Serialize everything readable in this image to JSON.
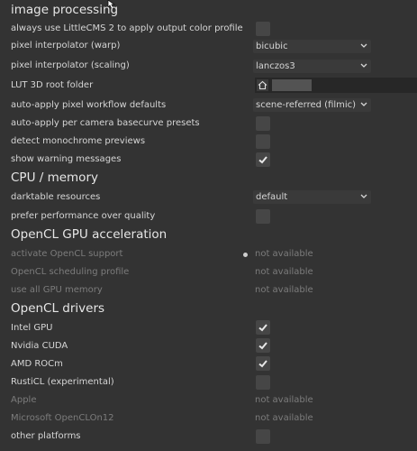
{
  "sections": {
    "image_processing": "image processing",
    "cpu_memory": "CPU / memory",
    "opencl_gpu": "OpenCL GPU acceleration",
    "opencl_drivers": "OpenCL drivers"
  },
  "image_processing": {
    "littlecms": {
      "label": "always use LittleCMS 2 to apply output color profile",
      "checked": false
    },
    "interp_warp": {
      "label": "pixel interpolator (warp)",
      "value": "bicubic"
    },
    "interp_scaling": {
      "label": "pixel interpolator (scaling)",
      "value": "lanczos3"
    },
    "lut_root": {
      "label": "LUT 3D root folder"
    },
    "workflow_defaults": {
      "label": "auto-apply pixel workflow defaults",
      "value": "scene-referred (filmic)"
    },
    "basecurve": {
      "label": "auto-apply per camera basecurve presets",
      "checked": false
    },
    "monochrome": {
      "label": "detect monochrome previews",
      "checked": false
    },
    "warnings": {
      "label": "show warning messages",
      "checked": true
    }
  },
  "cpu_memory": {
    "resources": {
      "label": "darktable resources",
      "value": "default"
    },
    "performance": {
      "label": "prefer performance over quality",
      "checked": false
    }
  },
  "opencl_gpu": {
    "activate": {
      "label": "activate OpenCL support",
      "value": "not available"
    },
    "scheduling": {
      "label": "OpenCL scheduling profile",
      "value": "not available"
    },
    "gpu_memory": {
      "label": "use all GPU memory",
      "value": "not available"
    }
  },
  "opencl_drivers": {
    "intel": {
      "label": "Intel GPU",
      "checked": true
    },
    "nvidia": {
      "label": "Nvidia CUDA",
      "checked": true
    },
    "amd": {
      "label": "AMD ROCm",
      "checked": true
    },
    "rusticl": {
      "label": "RustiCL (experimental)",
      "checked": false
    },
    "apple": {
      "label": "Apple",
      "value": "not available"
    },
    "microsoft": {
      "label": "Microsoft OpenCLOn12",
      "value": "not available"
    },
    "other": {
      "label": "other platforms",
      "checked": false
    }
  },
  "icons": {
    "checkmark": "checkmark-icon",
    "chevron": "chevron-down-icon",
    "home": "home-icon",
    "cursor": "mouse-cursor-icon"
  }
}
